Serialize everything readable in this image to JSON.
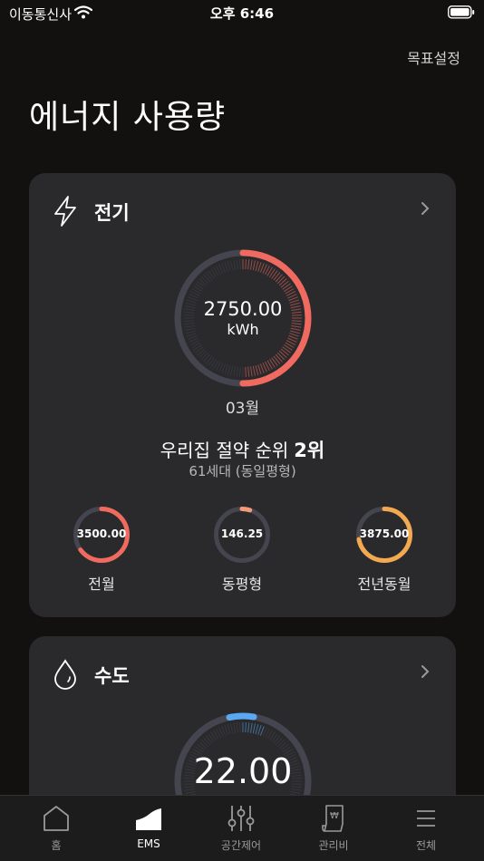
{
  "status_bar": {
    "carrier": "이동통신사",
    "time": "오후 6:46"
  },
  "header": {
    "goal_link": "목표설정",
    "title": "에너지 사용량"
  },
  "electricity": {
    "title": "전기",
    "main_value": "2750.00",
    "unit": "kWh",
    "main_progress": 0.5,
    "month": "03월",
    "rank_label": "우리집 절약 순위",
    "rank_value": "2위",
    "households": "61세대 (동일평형)",
    "comparisons": [
      {
        "value": "3500.00",
        "label": "전월",
        "progress": 0.65,
        "color": "#f06a60"
      },
      {
        "value": "146.25",
        "label": "동평형",
        "progress": 0.05,
        "color": "#f39a78"
      },
      {
        "value": "3875.00",
        "label": "전년동월",
        "progress": 0.72,
        "color": "#f3a950"
      }
    ]
  },
  "water": {
    "title": "수도",
    "main_value": "22.00",
    "main_progress": 0.06
  },
  "tabs": [
    {
      "label": "홈",
      "icon": "home-icon",
      "active": false
    },
    {
      "label": "EMS",
      "icon": "chart-icon",
      "active": true
    },
    {
      "label": "공간제어",
      "icon": "sliders-icon",
      "active": false
    },
    {
      "label": "관리비",
      "icon": "bill-icon",
      "active": false
    },
    {
      "label": "전체",
      "icon": "menu-icon",
      "active": false
    }
  ],
  "colors": {
    "accent": "#f06a60",
    "water_accent": "#5aa8f2",
    "track": "#45454f",
    "background": "#121110",
    "card": "#2a2a2c"
  }
}
